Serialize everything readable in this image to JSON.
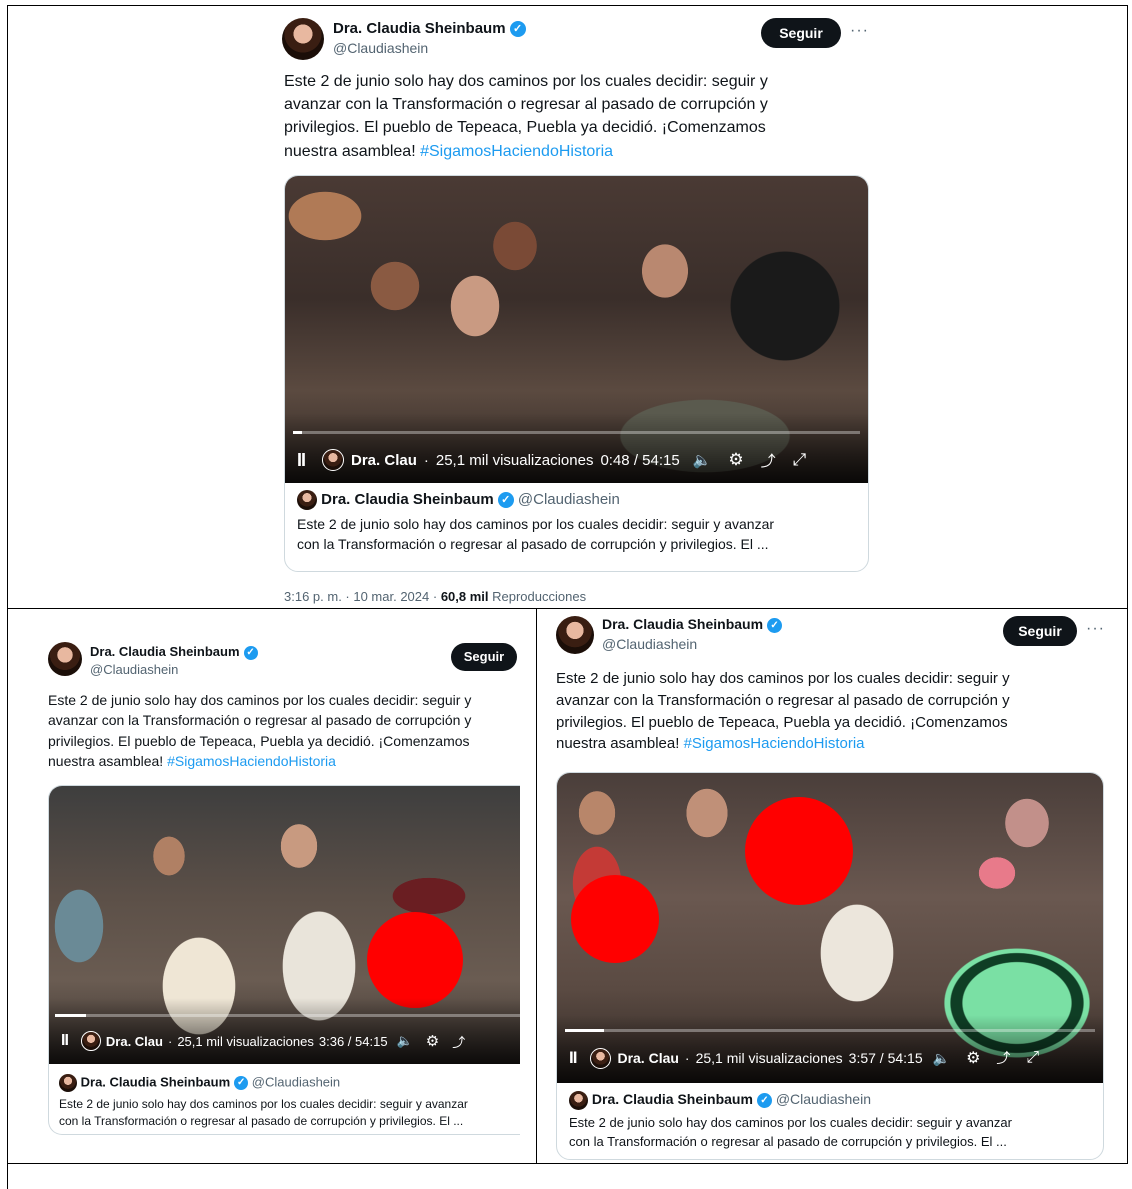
{
  "tweets": [
    {
      "author_name": "Dra. Claudia Sheinbaum",
      "handle": "@Claudiashein",
      "follow_label": "Seguir",
      "more_icon": "···",
      "text_lines": [
        "Este 2 de junio solo hay dos caminos por los cuales decidir: seguir y",
        "avanzar con la Transformación o regresar al pasado de corrupción y",
        "privilegios. El pueblo de Tepeaca, Puebla ya decidió. ¡Comenzamos",
        "nuestra asamblea!"
      ],
      "hashtag": "#SigamosHaciendoHistoria",
      "video": {
        "channel": "Dra. Clau",
        "separator": "·",
        "views": "25,1 mil visualizaciones",
        "time": "0:48 / 54:15",
        "progress": 0.015
      },
      "quote": {
        "name": "Dra. Claudia Sheinbaum",
        "handle": "@Claudiashein",
        "line1": "Este 2 de junio solo hay dos caminos por los cuales decidir: seguir y avanzar",
        "line2": "con la Transformación o regresar al pasado de corrupción y privilegios. El ..."
      },
      "meta": {
        "time": "3:16 p. m. · 10 mar. 2024 · ",
        "count": "60,8 mil",
        "label": " Reproducciones"
      }
    },
    {
      "author_name": "Dra. Claudia Sheinbaum",
      "handle": "@Claudiashein",
      "follow_label": "Seguir",
      "text_lines": [
        "Este 2 de junio solo hay dos caminos por los cuales decidir: seguir y",
        "avanzar con la Transformación o regresar al pasado de corrupción y",
        "privilegios. El pueblo de Tepeaca, Puebla ya decidió. ¡Comenzamos",
        "nuestra asamblea!"
      ],
      "hashtag": "#SigamosHaciendoHistoria",
      "video": {
        "channel": "Dra. Clau",
        "separator": "·",
        "views": "25,1 mil visualizaciones",
        "time": "3:36 / 54:15",
        "progress": 0.066
      },
      "quote": {
        "name": "Dra. Claudia Sheinbaum",
        "handle": "@Claudiashein",
        "line1": "Este 2 de junio solo hay dos caminos por los cuales decidir: seguir y avanzar",
        "line2": "con la Transformación o regresar al pasado de corrupción y privilegios. El ..."
      }
    },
    {
      "author_name": "Dra. Claudia Sheinbaum",
      "handle": "@Claudiashein",
      "follow_label": "Seguir",
      "more_icon": "···",
      "text_lines": [
        "Este 2 de junio solo hay dos caminos por los cuales decidir: seguir y",
        "avanzar con la Transformación o regresar al pasado de corrupción y",
        "privilegios. El pueblo de Tepeaca, Puebla ya decidió. ¡Comenzamos",
        "nuestra asamblea!"
      ],
      "hashtag": "#SigamosHaciendoHistoria",
      "video": {
        "channel": "Dra. Clau",
        "separator": "·",
        "views": "25,1 mil visualizaciones",
        "time": "3:57 / 54:15",
        "progress": 0.073
      },
      "quote": {
        "name": "Dra. Claudia Sheinbaum",
        "handle": "@Claudiashein",
        "line1": "Este 2 de junio solo hay dos caminos por los cuales decidir: seguir y avanzar",
        "line2": "con la Transformación o regresar al pasado de corrupción y privilegios. El ..."
      }
    }
  ],
  "icons": {
    "pause": "II",
    "volume": "🔈",
    "settings": "⚙",
    "share": "⤴",
    "fullscreen": "⤢",
    "verified": "✓"
  },
  "colors": {
    "link_blue": "#1d9bf0",
    "button_black": "#0f1419",
    "muted_gray": "#536471",
    "redaction_red": "#ff0000"
  }
}
